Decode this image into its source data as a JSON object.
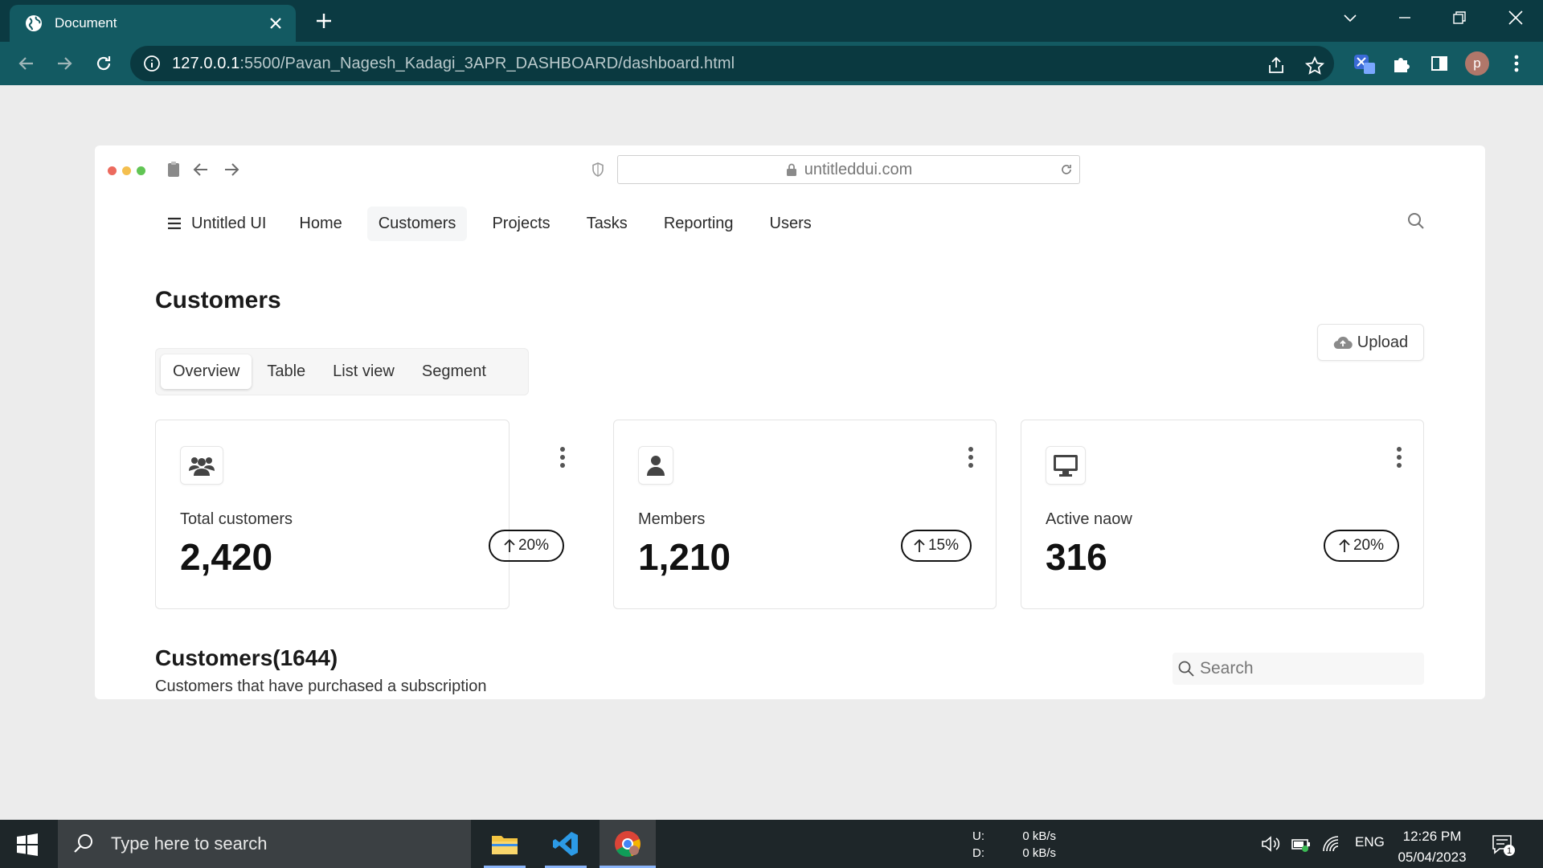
{
  "browser": {
    "tab_title": "Document",
    "url_host": "127.0.0.1",
    "url_rest": ":5500/Pavan_Nagesh_Kadagi_3APR_DASHBOARD/dashboard.html",
    "profile_initial": "p"
  },
  "inner_browser": {
    "url": "untitleddui.com"
  },
  "nav": {
    "brand": "Untitled UI",
    "items": [
      "Home",
      "Customers",
      "Projects",
      "Tasks",
      "Reporting",
      "Users"
    ],
    "active": "Customers"
  },
  "page": {
    "title": "Customers",
    "upload_label": "Upload",
    "view_tabs": [
      "Overview",
      "Table",
      "List view",
      "Segment"
    ],
    "selected_tab": "Overview"
  },
  "stats": [
    {
      "icon": "users-icon",
      "label": "Total customers",
      "value": "2,420",
      "change": "20%"
    },
    {
      "icon": "user-icon",
      "label": "Members",
      "value": "1,210",
      "change": "15%"
    },
    {
      "icon": "monitor-icon",
      "label": "Active naow",
      "value": "316",
      "change": "20%"
    }
  ],
  "customers_section": {
    "title": "Customers(1644)",
    "subtitle": "Customers that have purchased a subscription",
    "search_placeholder": "Search"
  },
  "taskbar": {
    "search_placeholder": "Type here to search",
    "net_up_label": "U:",
    "net_down_label": "D:",
    "net_up_value": "0 kB/s",
    "net_down_value": "0 kB/s",
    "language": "ENG",
    "time": "12:26 PM",
    "date": "05/04/2023",
    "notification_count": "1"
  },
  "colors": {
    "chrome_frame": "#0b3a42",
    "chrome_toolbar": "#135a62",
    "page_bg": "#ececec",
    "taskbar": "#1e2629"
  }
}
